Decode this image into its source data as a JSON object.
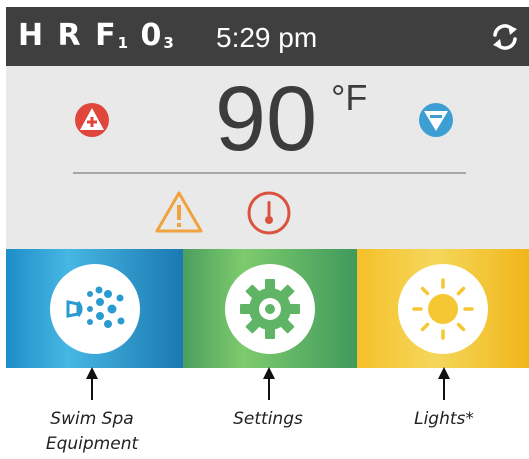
{
  "header": {
    "status_code": {
      "letters": "H R F",
      "sub1": "1",
      "zero": "0",
      "sub2": "3"
    },
    "clock": "5:29 pm",
    "refresh_icon": "refresh-icon"
  },
  "temperature": {
    "value": "90",
    "unit": "°F",
    "up_icon": "temp-up-icon",
    "down_icon": "temp-down-icon",
    "alert_icons": [
      "warning-icon",
      "thermometer-icon"
    ]
  },
  "tiles": [
    {
      "id": "equipment",
      "icon": "jets-icon",
      "label_line1": "Swim Spa",
      "label_line2": "Equipment"
    },
    {
      "id": "settings",
      "icon": "gear-icon",
      "label": "Settings"
    },
    {
      "id": "lights",
      "icon": "sun-icon",
      "label": "Lights*"
    }
  ],
  "colors": {
    "header_bg": "#3f3f3f",
    "panel_bg": "#e9e9e9",
    "up_button": "#e0463c",
    "down_button": "#3d9ed4",
    "warning": "#f0a33c",
    "thermometer": "#d9533f",
    "equipment_tile": "#2a9bd1",
    "settings_tile": "#5fb565",
    "lights_tile": "#f4c733"
  }
}
